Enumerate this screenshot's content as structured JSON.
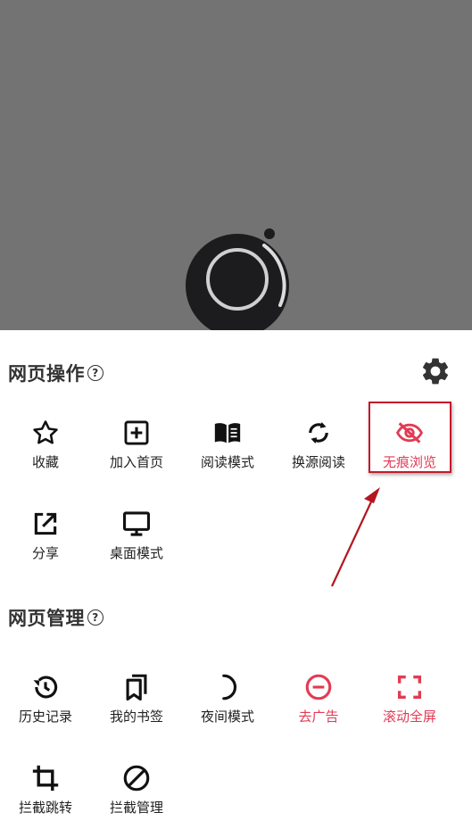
{
  "sections": {
    "web_actions": {
      "title": "网页操作",
      "items": [
        {
          "label": "收藏",
          "icon": "star-outline-icon"
        },
        {
          "label": "加入首页",
          "icon": "plus-box-icon"
        },
        {
          "label": "阅读模式",
          "icon": "open-book-icon"
        },
        {
          "label": "换源阅读",
          "icon": "refresh-icon"
        },
        {
          "label": "无痕浏览",
          "icon": "eye-off-icon"
        },
        {
          "label": "分享",
          "icon": "external-link-icon"
        },
        {
          "label": "桌面模式",
          "icon": "monitor-icon"
        }
      ]
    },
    "web_manage": {
      "title": "网页管理",
      "items": [
        {
          "label": "历史记录",
          "icon": "history-icon"
        },
        {
          "label": "我的书签",
          "icon": "bookmarks-icon"
        },
        {
          "label": "夜间模式",
          "icon": "moon-icon"
        },
        {
          "label": "去广告",
          "icon": "minus-circle-icon"
        },
        {
          "label": "滚动全屏",
          "icon": "fullscreen-icon"
        },
        {
          "label": "拦截跳转",
          "icon": "crop-icon"
        },
        {
          "label": "拦截管理",
          "icon": "block-icon"
        }
      ]
    }
  },
  "help_glyph": "?",
  "colors": {
    "accent_red": "#e23b55",
    "overlay": "#737373",
    "highlight_box": "#c21a2c"
  }
}
